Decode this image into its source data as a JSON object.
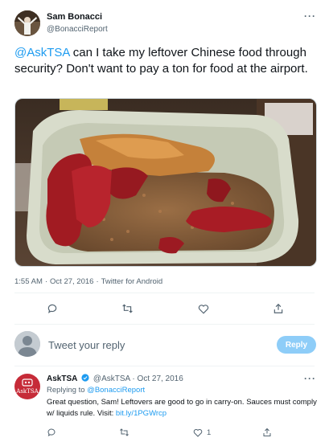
{
  "tweet": {
    "author_name": "Sam Bonacci",
    "author_handle": "@BonacciReport",
    "more_label": "···",
    "text_mention": "@AskTSA",
    "text_body": " can I take my leftover Chinese food through security? Don't want to pay a ton for food at the airport.",
    "time": "1:55 AM",
    "date": "Oct 27, 2016",
    "source": "Twitter for Android",
    "separator": "·"
  },
  "reply_box": {
    "placeholder": "Tweet your reply",
    "button_label": "Reply"
  },
  "reply_tweet": {
    "author_name": "AskTSA",
    "author_handle": "@AskTSA",
    "date": "Oct 27, 2016",
    "separator": "·",
    "more_label": "···",
    "avatar_text": "AskTSA",
    "replying_to_label": "Replying to ",
    "replying_to_handle": "@BonacciReport",
    "text_body": "Great question, Sam! Leftovers are good to go in carry-on. Sauces must comply w/ liquids rule. Visit: ",
    "text_link": "bit.ly/1PGWrcp",
    "like_count": "1"
  },
  "colors": {
    "accent": "#1d9bf0",
    "reply_button_bg": "#8ecdf8",
    "asktsa_brand": "#c62b38"
  },
  "icons": {
    "reply": "comment-icon",
    "retweet": "retweet-icon",
    "like": "heart-icon",
    "share": "share-icon",
    "verified": "verified-badge-icon"
  }
}
